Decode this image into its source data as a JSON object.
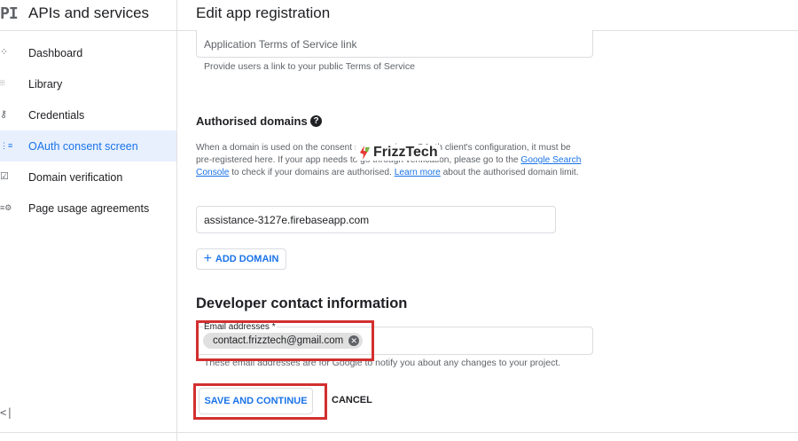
{
  "sidebar": {
    "logo": "PI",
    "title": "APIs and services",
    "items": [
      {
        "label": "Dashboard",
        "icon": "dashboard-icon",
        "glyph": "⁘"
      },
      {
        "label": "Library",
        "icon": "library-icon",
        "glyph": "⦙⦙⦙"
      },
      {
        "label": "Credentials",
        "icon": "key-icon",
        "glyph": "⚷"
      },
      {
        "label": "OAuth consent screen",
        "icon": "consent-icon",
        "glyph": "⋮≡"
      },
      {
        "label": "Domain verification",
        "icon": "checkbox-icon",
        "glyph": "☑"
      },
      {
        "label": "Page usage agreements",
        "icon": "settings-list-icon",
        "glyph": "≡⚙"
      }
    ],
    "active_index": 3,
    "collapse": "<|"
  },
  "header": {
    "title": "Edit app registration"
  },
  "tos": {
    "placeholder": "Application Terms of Service link",
    "helper": "Provide users a link to your public Terms of Service"
  },
  "domains": {
    "title": "Authorised domains",
    "help_glyph": "?",
    "desc_1": "When a domain is used on the consent screen or in an OAuth client's configuration, it must be",
    "desc_2": "pre-registered here. If your app needs to go through verification, please go to the ",
    "link_console_1": "Google Search",
    "link_console_2": "Console",
    "desc_3": " to check if your domains are authorised. ",
    "link_learn": "Learn more",
    "desc_4": " about the authorised domain limit.",
    "value": "assistance-3127e.firebaseapp.com",
    "add_label": "ADD DOMAIN",
    "add_glyph": "+"
  },
  "developer": {
    "title": "Developer contact information",
    "email_label": "Email addresses *",
    "chip": "contact.frizztech@gmail.com",
    "chip_close": "✕",
    "helper": "These email addresses are for Google to notify you about any changes to your project."
  },
  "actions": {
    "save": "SAVE AND CONTINUE",
    "cancel": "CANCEL"
  },
  "watermark": {
    "text": "FrizzTech"
  },
  "colors": {
    "accent": "#1a73e8",
    "active_bg": "#e8f0fe",
    "highlight": "#d32f2f"
  }
}
